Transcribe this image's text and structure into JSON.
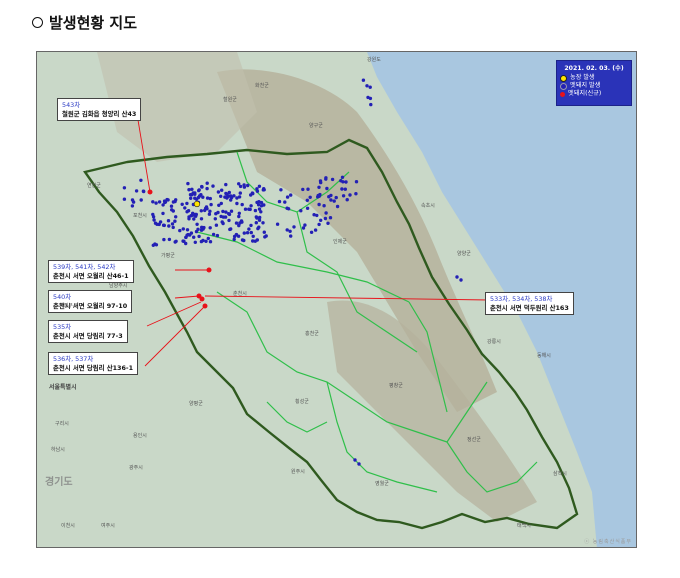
{
  "heading": {
    "title": "발생현황 지도"
  },
  "map": {
    "legend": {
      "date": "2021. 02. 03. (수)",
      "items": [
        {
          "label": "농장 발생",
          "color": "#ffe400"
        },
        {
          "label": "멧돼지 발생",
          "color": "#2320b5"
        },
        {
          "label": "멧돼지(신규)",
          "color": "#e8121a"
        }
      ]
    },
    "callouts": [
      {
        "case": "543차",
        "address": "철원군 김화읍 청양리 산43"
      },
      {
        "case": "539차, 541차, 542차",
        "address": "춘천시 서면 오월리 산46-1"
      },
      {
        "case": "540차",
        "address": "춘천시 서면 오월리 97-10"
      },
      {
        "case": "535차",
        "address": "춘천시 서면 당림리 77-3"
      },
      {
        "case": "536차, 537차",
        "address": "춘천시 서면 당림리 산136-1"
      },
      {
        "case": "533차, 534차, 538차",
        "address": "춘천시 서면 덕두원리 산163"
      }
    ],
    "place_labels": [
      "강원도",
      "철원군",
      "화천군",
      "양구군",
      "인제군",
      "속초시",
      "양양군",
      "춘천시",
      "홍천군",
      "강릉시",
      "평창군",
      "정선군",
      "횡성군",
      "원주시",
      "영월군",
      "동해시",
      "삼척시",
      "태백시",
      "가평군",
      "양평군",
      "포천시",
      "연천군",
      "의정부시",
      "구리시",
      "하남시",
      "여주시",
      "이천시",
      "용인시",
      "광주시",
      "남양주시"
    ],
    "region_label": "경기도",
    "city_label": "서울특별시",
    "watermark": "ⓒ 농림축산식품부"
  }
}
